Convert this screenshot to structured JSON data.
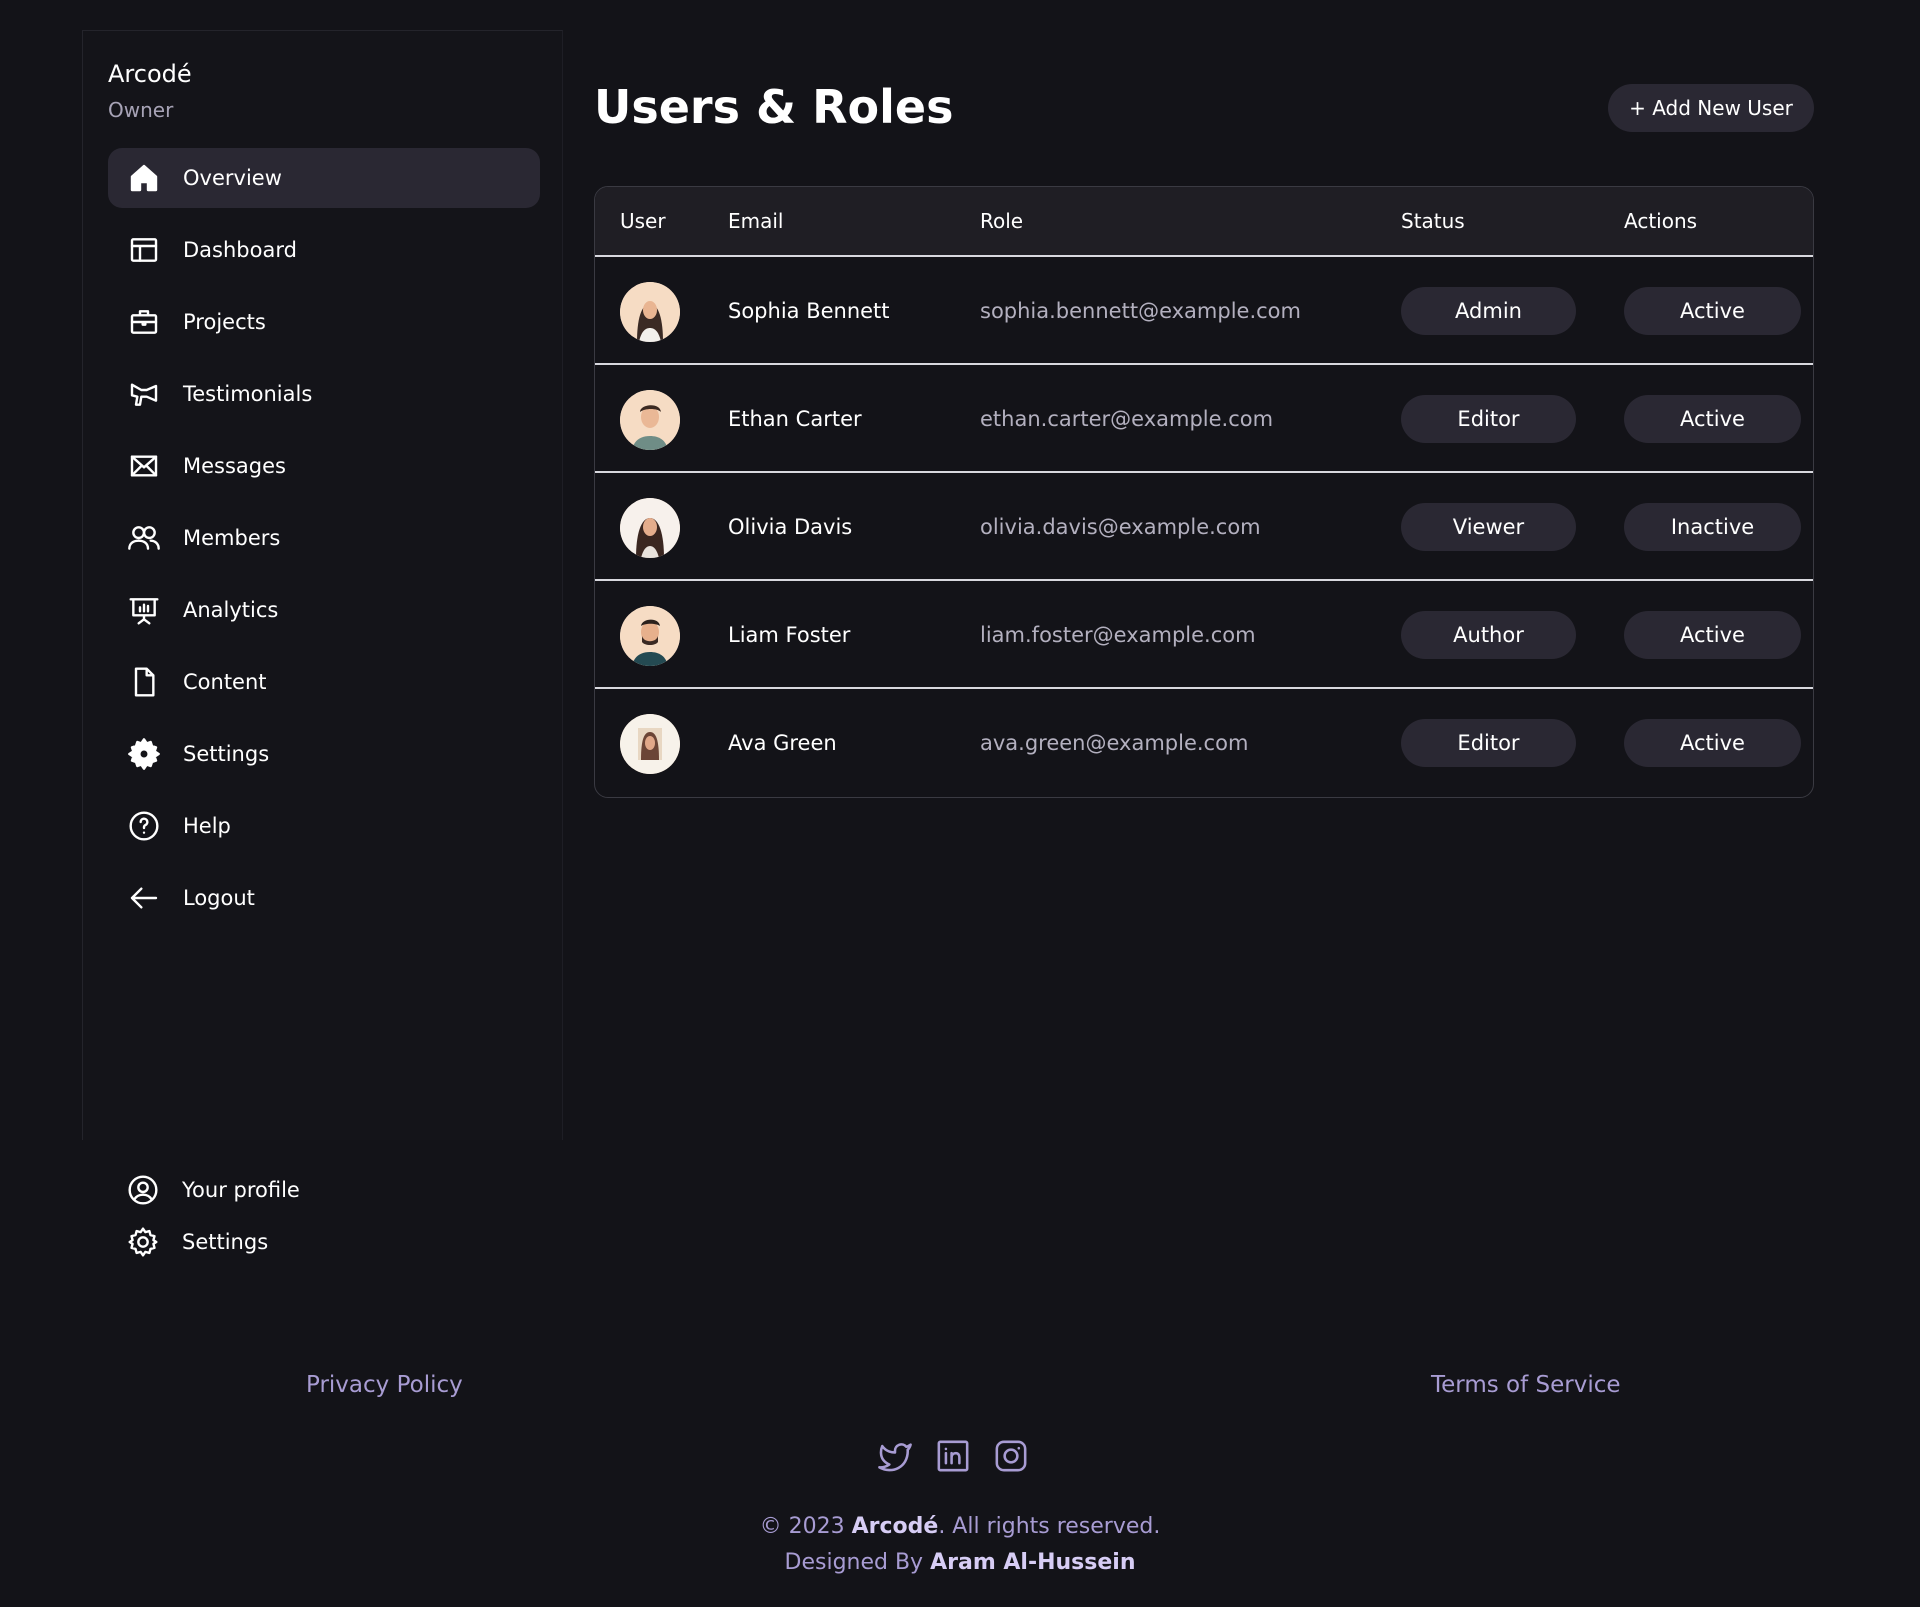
{
  "brand": {
    "name": "Arcodé",
    "role": "Owner"
  },
  "sidebar": {
    "items": [
      {
        "label": "Overview",
        "icon": "home-icon"
      },
      {
        "label": "Dashboard",
        "icon": "layout-icon"
      },
      {
        "label": "Projects",
        "icon": "briefcase-icon"
      },
      {
        "label": "Testimonials",
        "icon": "megaphone-icon"
      },
      {
        "label": "Messages",
        "icon": "mail-icon"
      },
      {
        "label": "Members",
        "icon": "users-icon"
      },
      {
        "label": "Analytics",
        "icon": "presentation-chart-icon"
      },
      {
        "label": "Content",
        "icon": "document-icon"
      },
      {
        "label": "Settings",
        "icon": "gear-icon"
      },
      {
        "label": "Help",
        "icon": "help-circle-icon"
      },
      {
        "label": "Logout",
        "icon": "arrow-left-icon"
      }
    ],
    "bottom": [
      {
        "label": "Your profile",
        "icon": "user-circle-icon"
      },
      {
        "label": "Settings",
        "icon": "gear-outline-icon"
      }
    ]
  },
  "main": {
    "title": "Users & Roles",
    "add_button": "+ Add New User",
    "columns": [
      "User",
      "Email",
      "Role",
      "Status",
      "Actions"
    ],
    "rows": [
      {
        "name": "Sophia Bennett",
        "email": "sophia.bennett@example.com",
        "role": "Admin",
        "status": "Active"
      },
      {
        "name": "Ethan Carter",
        "email": "ethan.carter@example.com",
        "role": "Editor",
        "status": "Active"
      },
      {
        "name": "Olivia Davis",
        "email": "olivia.davis@example.com",
        "role": "Viewer",
        "status": "Inactive"
      },
      {
        "name": "Liam Foster",
        "email": "liam.foster@example.com",
        "role": "Author",
        "status": "Active"
      },
      {
        "name": "Ava Green",
        "email": "ava.green@example.com",
        "role": "Editor",
        "status": "Active"
      }
    ]
  },
  "footer": {
    "privacy": "Privacy Policy",
    "terms": "Terms of Service",
    "social": [
      "twitter-icon",
      "linkedin-icon",
      "instagram-icon"
    ],
    "copyright_prefix": "© 2023",
    "copyright_brand": "Arcodé",
    "copyright_suffix": ". All rights reserved.",
    "designed_prefix": "Designed By",
    "designed_name": "Aram Al-Hussein"
  },
  "colors": {
    "background": "#131318",
    "pill": "#2a2833",
    "accent_text": "#a89cd3"
  }
}
